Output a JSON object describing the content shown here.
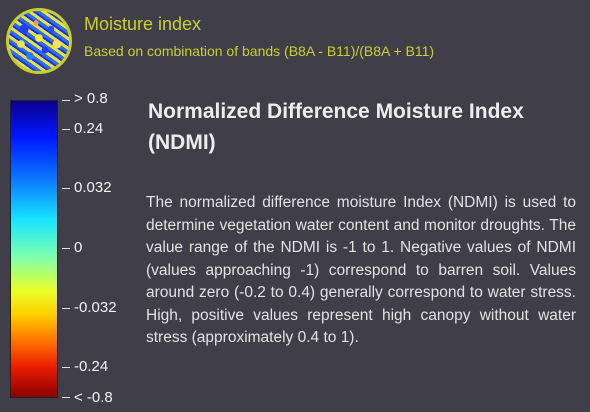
{
  "header": {
    "title": "Moisture index",
    "subtitle": "Based on combination of bands (B8A - B11)/(B8A + B11)"
  },
  "legend": {
    "labels": [
      "> 0.8",
      "0.24",
      "0.032",
      "0",
      "-0.032",
      "-0.24",
      "< -0.8"
    ],
    "color_stops": [
      "#0b008f",
      "#0016ff",
      "#0b7cff",
      "#16e4ff",
      "#78ffb5",
      "#e8ff28",
      "#ffd000",
      "#ff6a00",
      "#e81c00",
      "#8c0000"
    ]
  },
  "main": {
    "title": "Normalized Difference Moisture Index (NDMI)",
    "body": "The normalized difference moisture Index (NDMI) is used to determine vegetation water content and monitor droughts. The value range of the NDMI is -1 to 1. Negative values of NDMI (values approaching -1) correspond to barren soil. Values around zero (-0.2 to 0.4) generally correspond to water stress. High, positive values represent high canopy without water stress (approximately 0.4 to 1)."
  }
}
